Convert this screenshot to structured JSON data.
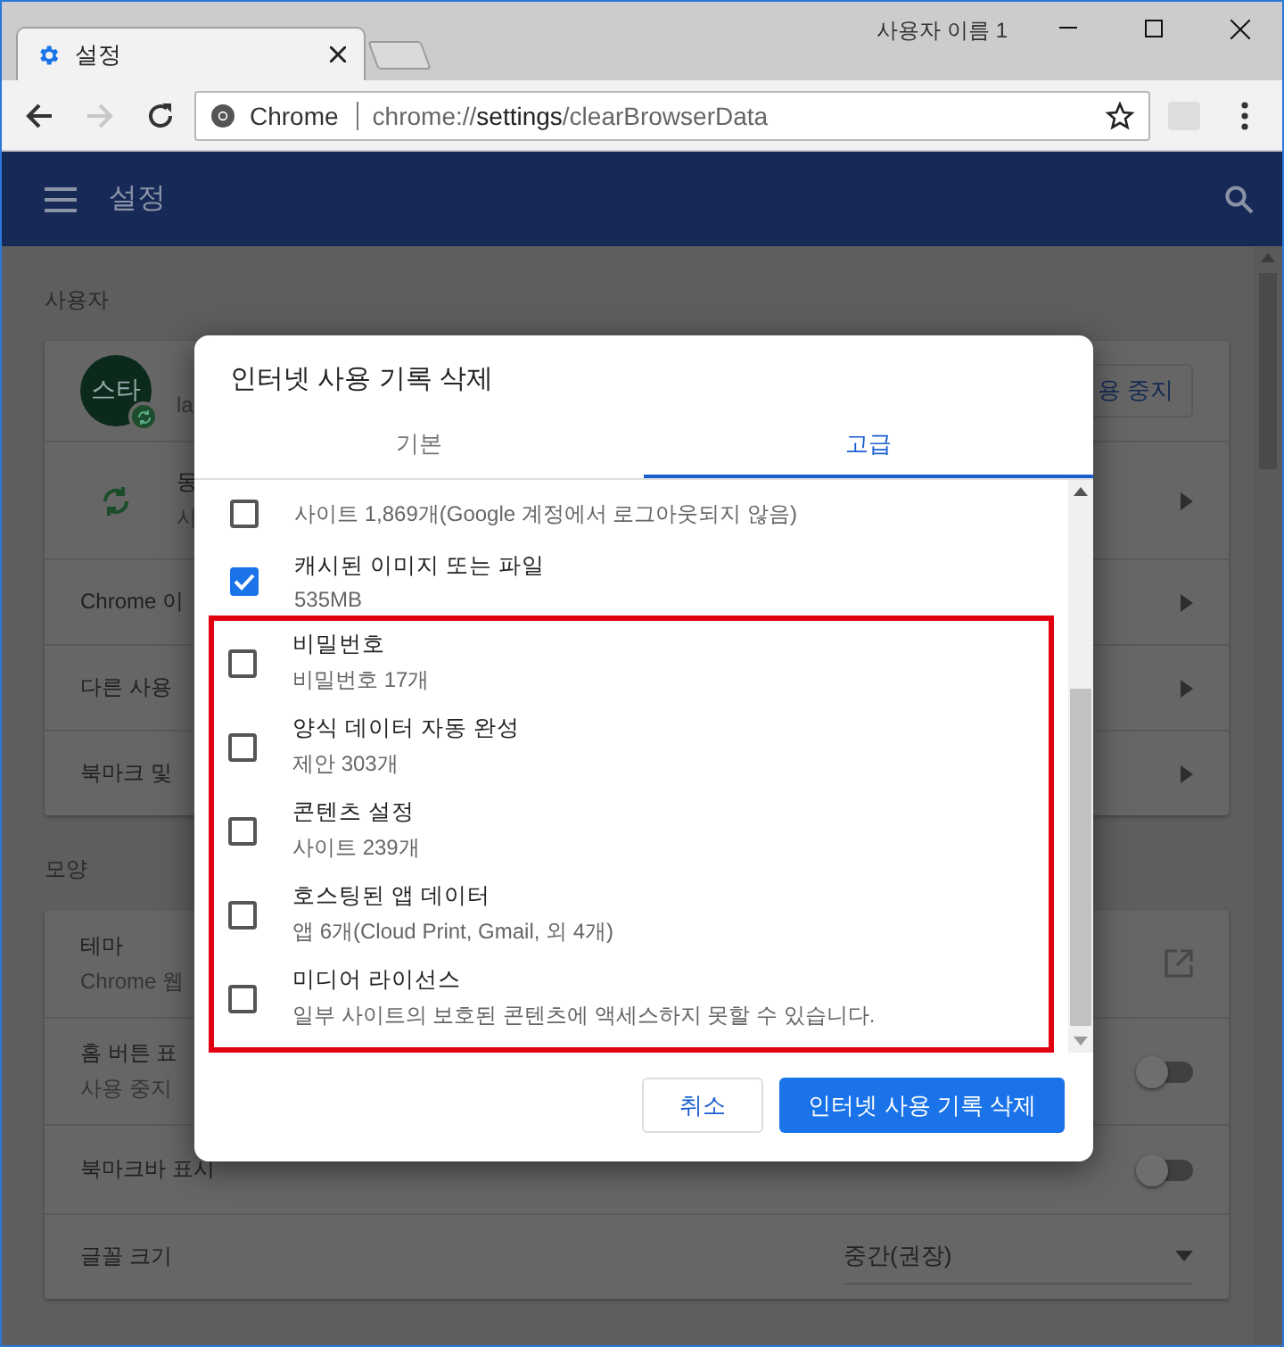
{
  "window": {
    "profile_name": "사용자 이름 1"
  },
  "tabs": [
    {
      "title": "설정",
      "selected": true
    }
  ],
  "toolbar": {
    "forward_disabled": true
  },
  "address_bar": {
    "origin_label": "Chrome",
    "url": "chrome://**settings**/clearBrowserData"
  },
  "header": {
    "title": "설정"
  },
  "sections": [
    {
      "title": "사용자",
      "rows": [
        {
          "kind": "profile",
          "avatar_text": "스타",
          "subtitle": "la",
          "action": "용 중지"
        },
        {
          "kind": "sync",
          "title": "동",
          "subtitle": "사"
        },
        {
          "kind": "link",
          "title": "Chrome 이"
        },
        {
          "kind": "link",
          "title": "다른 사용"
        },
        {
          "kind": "link",
          "title": "북마크 및"
        }
      ]
    },
    {
      "title": "모양",
      "rows": [
        {
          "kind": "external",
          "title": "테마",
          "subtitle": "Chrome 웹"
        },
        {
          "kind": "toggle",
          "title": "홈 버튼 표",
          "subtitle": "사용 중지",
          "on": false
        },
        {
          "kind": "toggle",
          "title": "북마크바 표시",
          "on": false
        },
        {
          "kind": "select",
          "title": "글꼴 크기",
          "value": "중간(권장)"
        }
      ]
    }
  ],
  "dialog": {
    "title": "인터넷 사용 기록 삭제",
    "tabs": [
      {
        "label": "기본",
        "selected": false
      },
      {
        "label": "고급",
        "selected": true
      }
    ],
    "items": [
      {
        "sublabel": "사이트 1,869개(Google 계정에서 로그아웃되지 않음)",
        "checked": false,
        "highlighted": false
      },
      {
        "label": "캐시된 이미지 또는 파일",
        "sublabel": "535MB",
        "checked": true,
        "highlighted": false
      },
      {
        "label": "비밀번호",
        "sublabel": "비밀번호 17개",
        "checked": false,
        "highlighted": true
      },
      {
        "label": "양식 데이터 자동 완성",
        "sublabel": "제안 303개",
        "checked": false,
        "highlighted": true
      },
      {
        "label": "콘텐츠 설정",
        "sublabel": "사이트 239개",
        "checked": false,
        "highlighted": true
      },
      {
        "label": "호스팅된 앱 데이터",
        "sublabel": "앱 6개(Cloud Print, Gmail, 외 4개)",
        "checked": false,
        "highlighted": true
      },
      {
        "label": "미디어 라이선스",
        "sublabel": "일부 사이트의 보호된 콘텐츠에 액세스하지 못할 수 있습니다.",
        "checked": false,
        "highlighted": true
      }
    ],
    "cancel": "취소",
    "confirm": "인터넷 사용 기록 삭제"
  }
}
